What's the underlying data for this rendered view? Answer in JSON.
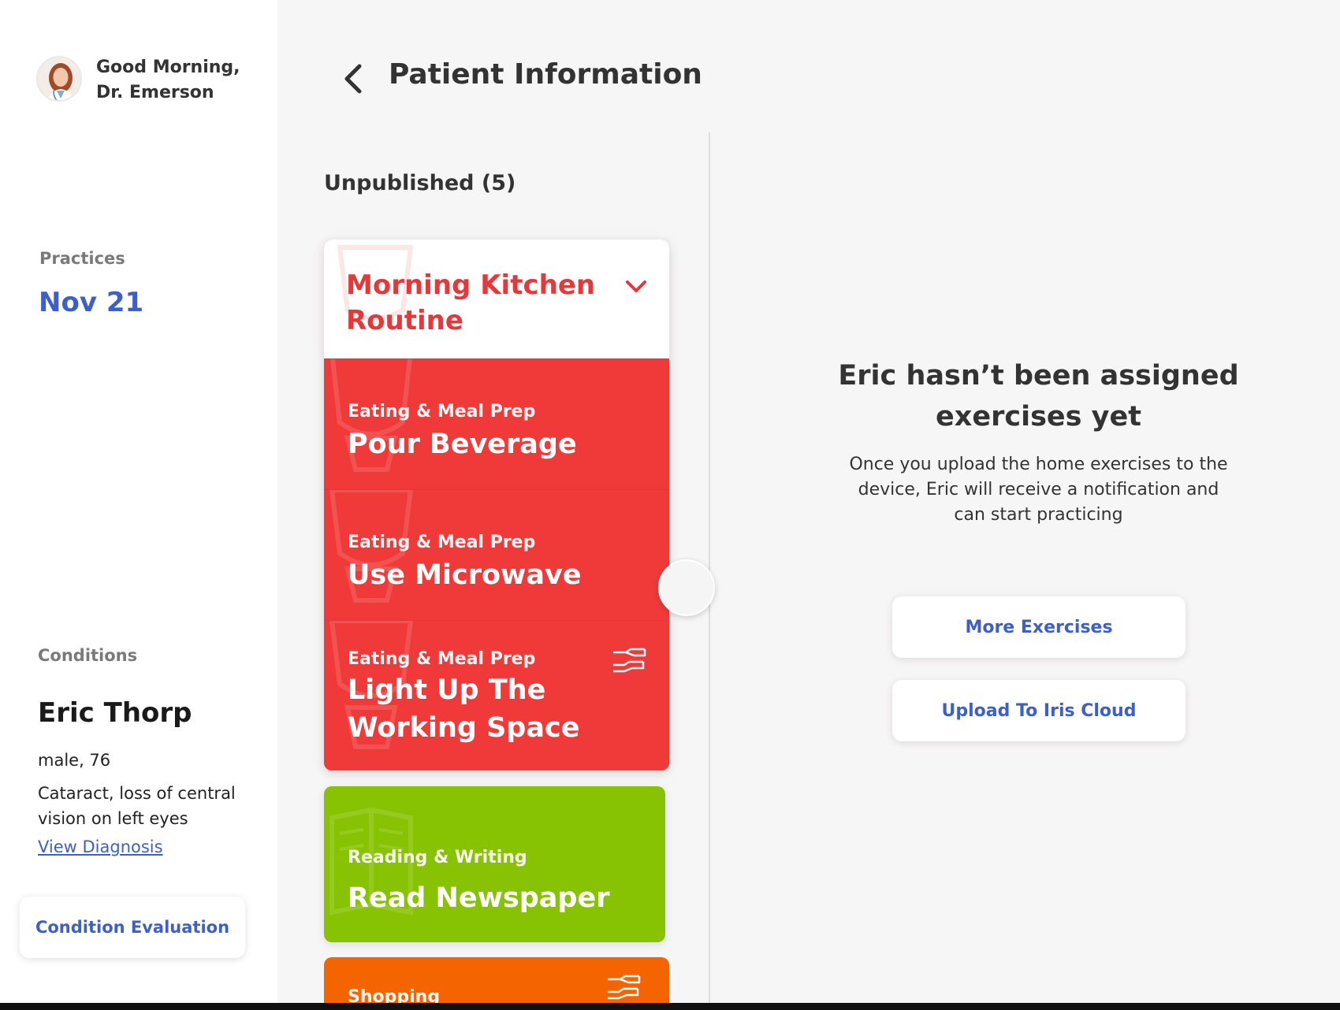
{
  "sidebar": {
    "greeting_line1": "Good Morning,",
    "greeting_line2": "Dr. Emerson",
    "practices_label": "Practices",
    "practices_date": "Nov 21",
    "conditions_label": "Conditions",
    "patient_name": "Eric Thorp",
    "patient_meta": "male, 76",
    "patient_condition": "Cataract, loss of central vision on left eyes",
    "view_diagnosis": "View Diagnosis",
    "condition_evaluation": "Condition Evaluation"
  },
  "header": {
    "title": "Patient Information"
  },
  "list": {
    "section_title": "Unpublished (5)",
    "routine": {
      "title": "Morning Kitchen Routine",
      "color": "#f03a3a",
      "exercises": [
        {
          "category": "Eating & Meal Prep",
          "title": "Pour Beverage"
        },
        {
          "category": "Eating & Meal Prep",
          "title": "Use Microwave"
        },
        {
          "category": "Eating & Meal Prep",
          "title": "Light Up The Working Space",
          "icon": "helping-hands-icon"
        }
      ]
    },
    "cards": [
      {
        "category": "Reading & Writing",
        "title": "Read Newspaper",
        "color": "#87c302"
      },
      {
        "category": "Shopping",
        "title": "",
        "color": "#f46502",
        "icon": "helping-hands-icon"
      }
    ]
  },
  "empty_state": {
    "title": "Eric hasn’t been assigned exercises yet",
    "description": "Once you upload the home exercises to the device, Eric will receive a notification and can start practicing",
    "more_exercises": "More Exercises",
    "upload": "Upload To Iris Cloud"
  },
  "colors": {
    "accent_blue": "#3c5fc8",
    "routine_red": "#e4383a"
  }
}
